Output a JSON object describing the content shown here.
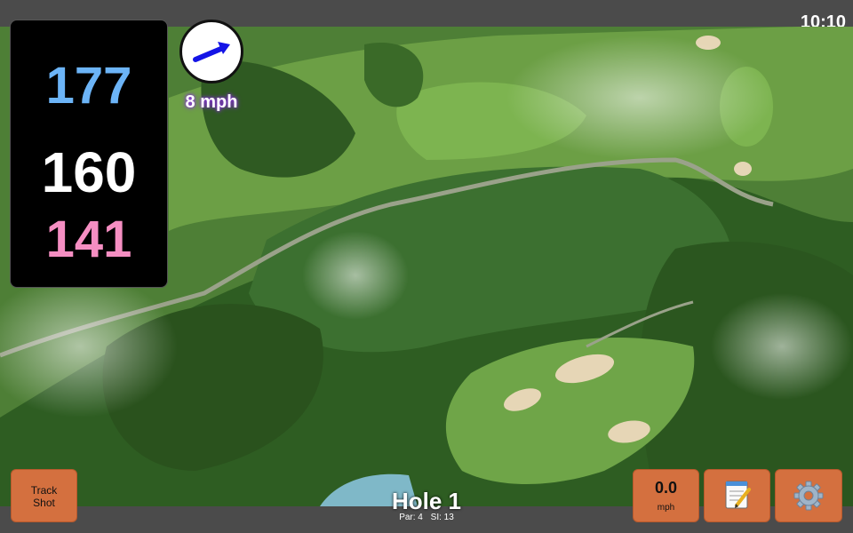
{
  "status_bar": {
    "time": "10:10"
  },
  "distances": {
    "back": "177",
    "middle": "160",
    "front": "141"
  },
  "wind": {
    "speed_label": "8 mph",
    "direction_icon": "wind-arrow-icon"
  },
  "buttons": {
    "track_shot_line1": "Track",
    "track_shot_line2": "Shot",
    "wind_value": "0.0",
    "wind_unit": "mph",
    "notes_icon": "notepad-icon",
    "settings_icon": "gear-icon"
  },
  "hole": {
    "title": "Hole 1",
    "par": "Par: 4",
    "si": "SI: 13"
  },
  "colors": {
    "back_distance": "#6cb4f7",
    "middle_distance": "#ffffff",
    "front_distance": "#f58ec2",
    "button": "#d4703f",
    "wind_arrow": "#1414e6"
  }
}
